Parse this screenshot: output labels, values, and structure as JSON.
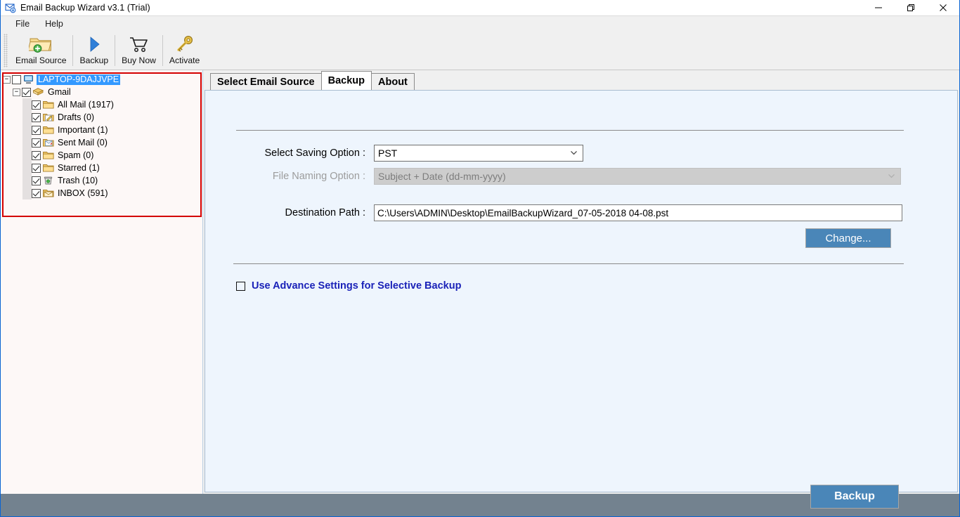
{
  "window": {
    "title": "Email Backup Wizard v3.1 (Trial)",
    "icon": "envelope-app-icon",
    "controls": {
      "minimize": "minimize-icon",
      "restore": "restore-icon",
      "close": "close-icon"
    }
  },
  "menubar": {
    "items": [
      {
        "label": "File"
      },
      {
        "label": "Help"
      }
    ]
  },
  "toolbar": {
    "buttons": [
      {
        "label": "Email Source",
        "icon": "folder-add-icon"
      },
      {
        "label": "Backup",
        "icon": "play-triangle-icon"
      },
      {
        "label": "Buy Now",
        "icon": "shopping-cart-icon"
      },
      {
        "label": "Activate",
        "icon": "key-icon"
      }
    ]
  },
  "tree": {
    "root": {
      "label": "LAPTOP-9DAJJVPE",
      "icon": "computer-icon",
      "checked": false,
      "selected": true,
      "expanded": true
    },
    "account": {
      "label": "Gmail",
      "icon": "mail-stack-icon",
      "checked": true,
      "expanded": true
    },
    "folders": [
      {
        "label": "All Mail (1917)",
        "icon": "folder-icon",
        "checked": true
      },
      {
        "label": "Drafts (0)",
        "icon": "drafts-pencil-icon",
        "checked": true
      },
      {
        "label": "Important (1)",
        "icon": "folder-icon",
        "checked": true
      },
      {
        "label": "Sent Mail (0)",
        "icon": "sent-mail-icon",
        "checked": true
      },
      {
        "label": "Spam (0)",
        "icon": "folder-icon",
        "checked": true
      },
      {
        "label": "Starred (1)",
        "icon": "folder-icon",
        "checked": true
      },
      {
        "label": "Trash (10)",
        "icon": "trash-bin-icon",
        "checked": true
      },
      {
        "label": "INBOX (591)",
        "icon": "inbox-envelope-icon",
        "checked": true
      }
    ]
  },
  "tabs": [
    {
      "label": "Select Email Source",
      "active": false
    },
    {
      "label": "Backup",
      "active": true
    },
    {
      "label": "About",
      "active": false
    }
  ],
  "backup_form": {
    "saving_option": {
      "label": "Select Saving Option :",
      "value": "PST",
      "disabled": false
    },
    "file_naming_option": {
      "label": "File Naming Option :",
      "value": "Subject + Date (dd-mm-yyyy)",
      "disabled": true
    },
    "destination_path": {
      "label": "Destination Path :",
      "value": "C:\\Users\\ADMIN\\Desktop\\EmailBackupWizard_07-05-2018 04-08.pst"
    },
    "change_button": "Change...",
    "advance_settings": {
      "label": "Use Advance Settings for Selective Backup",
      "checked": false
    },
    "backup_button": "Backup"
  },
  "colors": {
    "accent_blue": "#4a86b8",
    "tree_selection": "#3399ff",
    "annotation_red": "#d40000",
    "link_navy": "#1a22b8",
    "panel_bg": "#eef5fd",
    "statusbar": "#73828f"
  }
}
